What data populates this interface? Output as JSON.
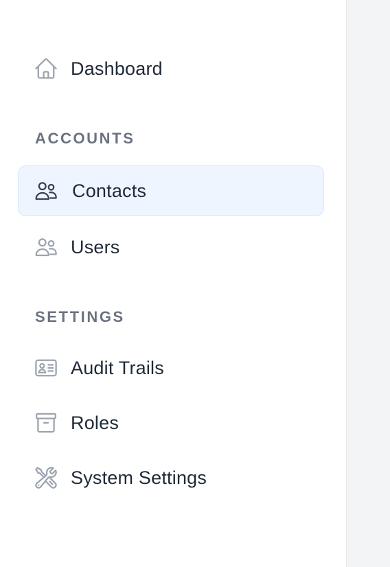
{
  "sidebar": {
    "dashboard": {
      "label": "Dashboard",
      "icon": "home-icon"
    },
    "sections": [
      {
        "title": "ACCOUNTS",
        "items": [
          {
            "label": "Contacts",
            "icon": "users-icon",
            "active": true
          },
          {
            "label": "Users",
            "icon": "users-icon",
            "active": false
          }
        ]
      },
      {
        "title": "SETTINGS",
        "items": [
          {
            "label": "Audit Trails",
            "icon": "id-card-icon",
            "active": false
          },
          {
            "label": "Roles",
            "icon": "archive-box-icon",
            "active": false
          },
          {
            "label": "System Settings",
            "icon": "wrench-screwdriver-icon",
            "active": false
          }
        ]
      }
    ]
  },
  "colors": {
    "active_background": "#eef5fe",
    "active_border": "#d6e6f9",
    "icon_inactive": "#9ca3af",
    "icon_active": "#374151",
    "text": "#1f2937",
    "section_title": "#6b7280"
  }
}
